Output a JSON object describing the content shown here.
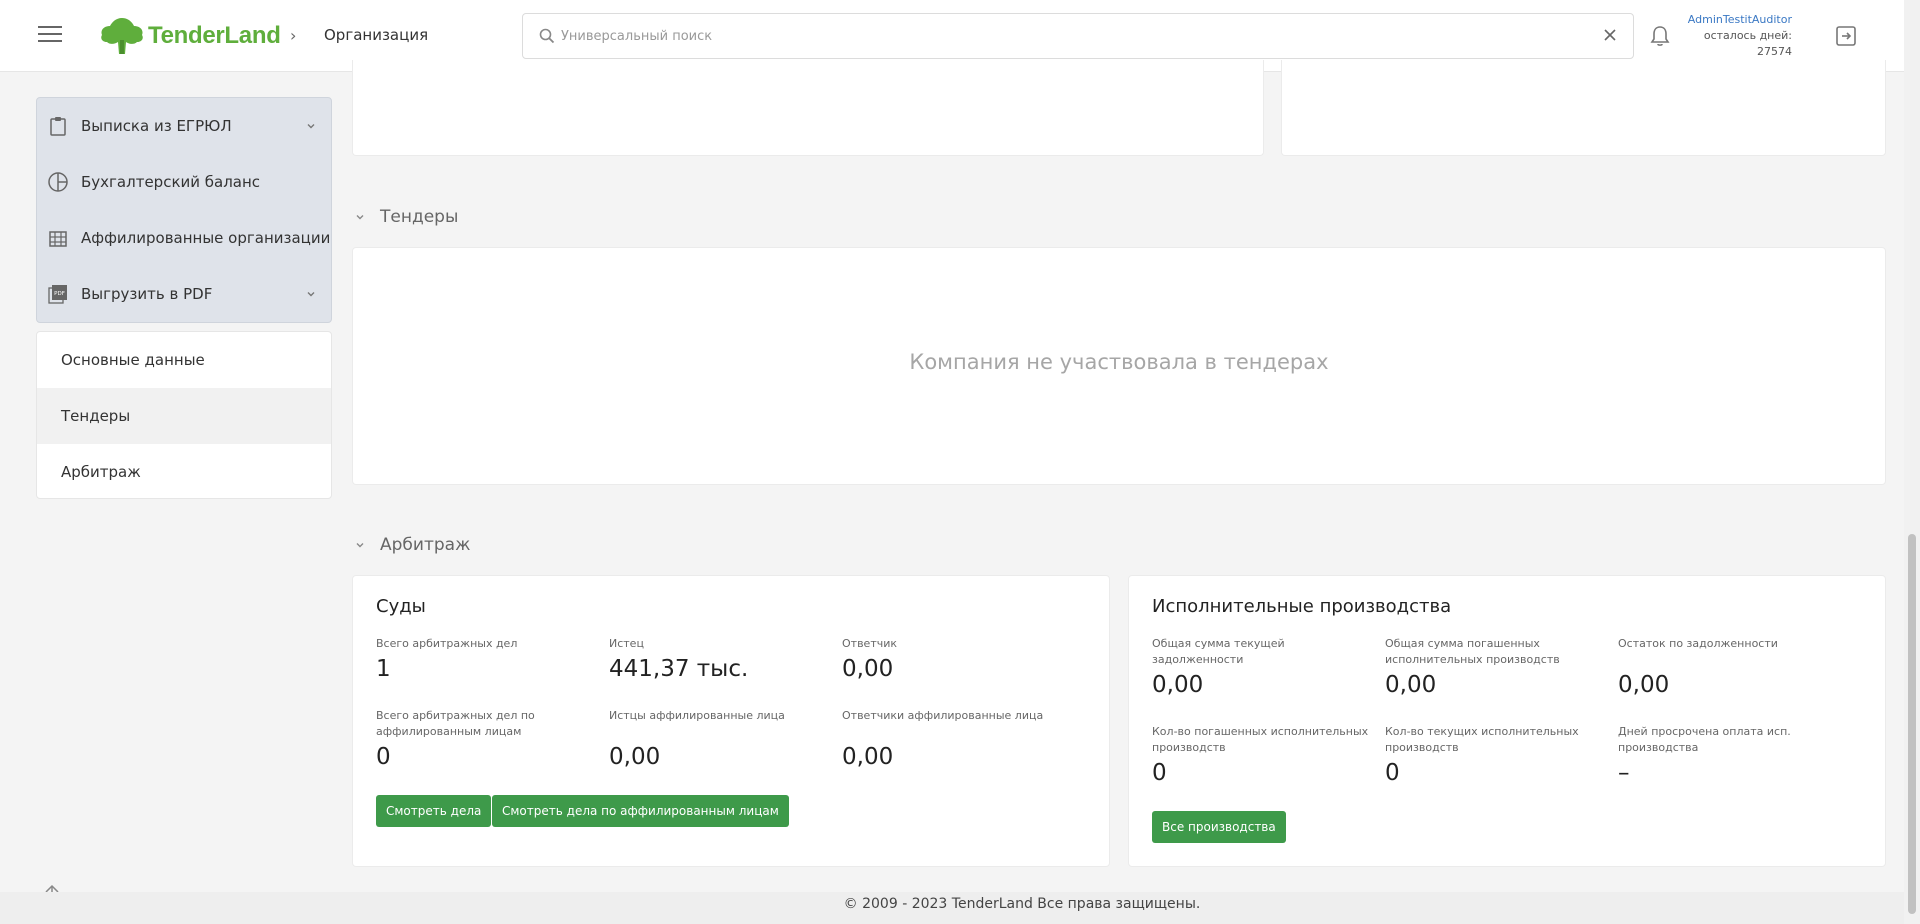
{
  "header": {
    "logo_text": "TenderLand",
    "breadcrumb": "Организация",
    "search_placeholder": "Универсальный поиск",
    "user_name": "AdminTestitAuditor",
    "user_days_label": "осталось дней:",
    "user_days_value": "27574"
  },
  "sidebar": {
    "actions": [
      {
        "label": "Выписка из ЕГРЮЛ"
      },
      {
        "label": "Бухгалтерский баланс"
      },
      {
        "label": "Аффилированные организации"
      },
      {
        "label": "Выгрузить в PDF"
      }
    ],
    "nav": [
      {
        "label": "Основные данные"
      },
      {
        "label": "Тендеры"
      },
      {
        "label": "Арбитраж"
      }
    ]
  },
  "tenders": {
    "title": "Тендеры",
    "empty_message": "Компания не участвовала в тендерах"
  },
  "arbitration": {
    "title": "Арбитраж",
    "courts": {
      "title": "Суды",
      "metrics": [
        {
          "label": "Всего арбитражных дел",
          "value": "1"
        },
        {
          "label": "Истец",
          "value": "441,37 тыс."
        },
        {
          "label": "Ответчик",
          "value": "0,00"
        },
        {
          "label": "Всего арбитражных дел по аффилированным лицам",
          "value": "0"
        },
        {
          "label": "Истцы аффилированные лица",
          "value": "0,00"
        },
        {
          "label": "Ответчики аффилированные лица",
          "value": "0,00"
        }
      ],
      "btn_cases": "Смотреть дела",
      "btn_affiliated_cases": "Смотреть дела по аффилированным лицам"
    },
    "enforcement": {
      "title": "Исполнительные производства",
      "metrics": [
        {
          "label": "Общая сумма текущей задолженности",
          "value": "0,00"
        },
        {
          "label": "Общая сумма погашенных исполнительных производств",
          "value": "0,00"
        },
        {
          "label": "Остаток по задолженности",
          "value": "0,00"
        },
        {
          "label": "Кол-во погашенных исполнительных производств",
          "value": "0"
        },
        {
          "label": "Кол-во текущих исполнительных производств",
          "value": "0"
        },
        {
          "label": "Дней просрочена оплата исп. производства",
          "value": "–"
        }
      ],
      "btn_all": "Все производства"
    }
  },
  "footer": {
    "copyright": "© 2009 - 2023 TenderLand Все права защищены."
  },
  "colors": {
    "brand_green": "#5fae3c",
    "button_green": "#3e9a4a",
    "link_blue": "#3a78c4"
  }
}
